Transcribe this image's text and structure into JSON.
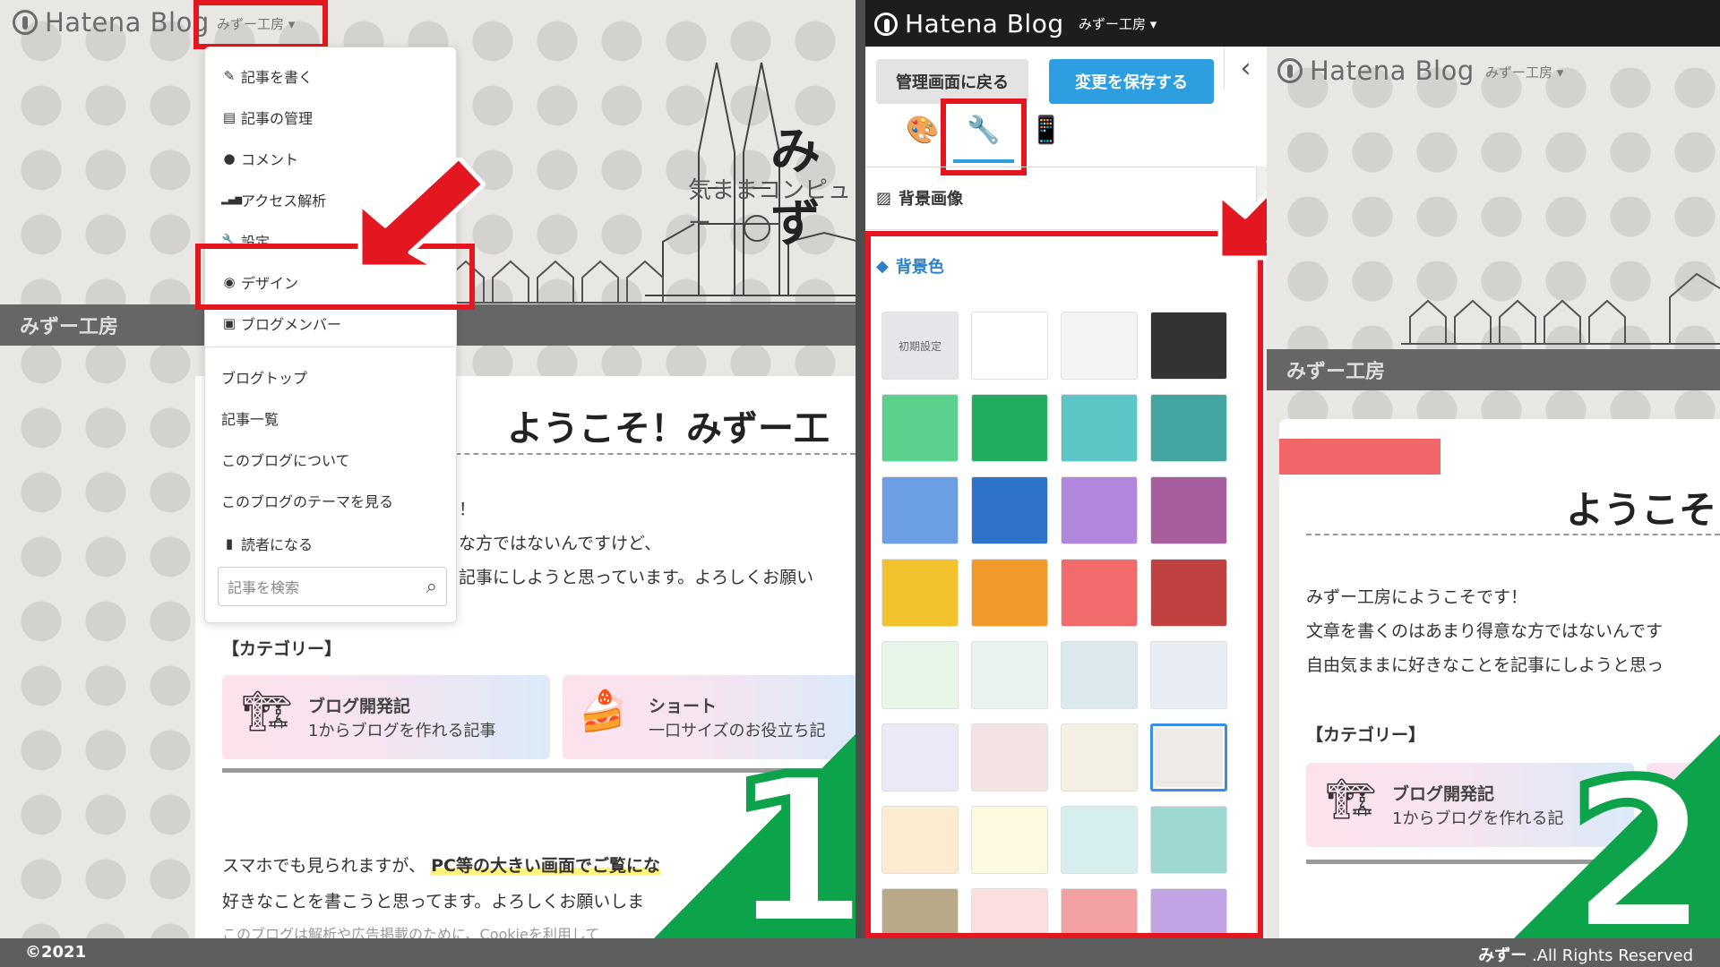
{
  "brand": {
    "name": "Hatena Blog",
    "user_menu": "みずー工房 ▾"
  },
  "blog": {
    "title_partial": "みず",
    "subtitle_partial": "気ままコンピュー",
    "strip_name": "みずー工房",
    "welcome_heading": "ようこそ！みずー工",
    "welcome_heading_right": "ようこそ",
    "intro_lines_left": [
      "！",
      "な方ではないんですけど、",
      "記事にしようと思っています。よろしくお願い"
    ],
    "intro_lines_right": [
      "みずー工房にようこそです！",
      "文章を書くのはあまり得意な方ではないんです",
      "自由気ままに好きなことを記事にしようと思っ"
    ],
    "category_heading": "【カテゴリー】",
    "categories": [
      {
        "title": "ブログ開発記",
        "sub": "1からブログを作れる記事"
      },
      {
        "title": "ショート",
        "sub": "一口サイズのお役立ち記"
      }
    ],
    "category_right_sub": "1からブログを作れる記",
    "bottom_line1_a": "スマホでも見られますが、",
    "bottom_line1_b": "PC等の大きい画面でご覧にな",
    "bottom_line2": "好きなことを書こうと思ってます。よろしくお願いしま",
    "bottom_line3": "このブログは解析や広告掲載のために、Cookieを利用して"
  },
  "dropdown": {
    "items": [
      {
        "icon": "✎",
        "label": "記事を書く"
      },
      {
        "icon": "▤",
        "label": "記事の管理"
      },
      {
        "icon": "●",
        "label": "コメント"
      },
      {
        "icon": "▂▄▆",
        "label": "アクセス解析"
      },
      {
        "icon": "🔧",
        "label": "設定"
      },
      {
        "icon": "◉",
        "label": "デザイン"
      },
      {
        "icon": "▣",
        "label": "ブログメンバー"
      }
    ],
    "links": [
      "ブログトップ",
      "記事一覧",
      "このブログについて",
      "このブログのテーマを見る"
    ],
    "reader": {
      "icon": "▮",
      "label": "読者になる"
    },
    "search_placeholder": "記事を検索"
  },
  "editor": {
    "back_label": "管理画面に戻る",
    "save_label": "変更を保存する",
    "collapse": "‹",
    "tabs": [
      "palette-icon",
      "wrench-icon",
      "mobile-icon"
    ],
    "section_bg_image": "背景画像",
    "section_bg_color": "背景色",
    "default_label": "初期設定",
    "swatches": [
      [
        "default",
        "#ffffff",
        "#f3f3f3",
        "#333333"
      ],
      [
        "#5bd18e",
        "#22ac5f",
        "#5bc6c5",
        "#43a4a0"
      ],
      [
        "#6b9ee2",
        "#2f72c9",
        "#b087dd",
        "#a85d9e"
      ],
      [
        "#f1c12e",
        "#f29a2b",
        "#f06b69",
        "#c14040"
      ],
      [
        "#e8f5e9",
        "#e8f3f1",
        "#dce9ec",
        "#e8ecf3"
      ],
      [
        "#ede8f5",
        "#f4e3e3",
        "#f4efe3",
        "#eeebe6"
      ],
      [
        "#fdebd1",
        "#fdf9df",
        "#d6eeee",
        "#9fd7d3"
      ],
      [
        "#b8aa88",
        "#fddede",
        "#f2a0a0",
        "#c1a4e3"
      ]
    ],
    "selected_index": 23
  },
  "markers": {
    "one": "1",
    "two": "2"
  },
  "footer": {
    "left": "©2021",
    "right_bold": "みずー",
    "right_rest": ".All Rights Reserved"
  },
  "colors": {
    "highlight_red": "#e4161f",
    "accent_blue": "#2d9ee0",
    "marker_green": "#0ca34a"
  }
}
